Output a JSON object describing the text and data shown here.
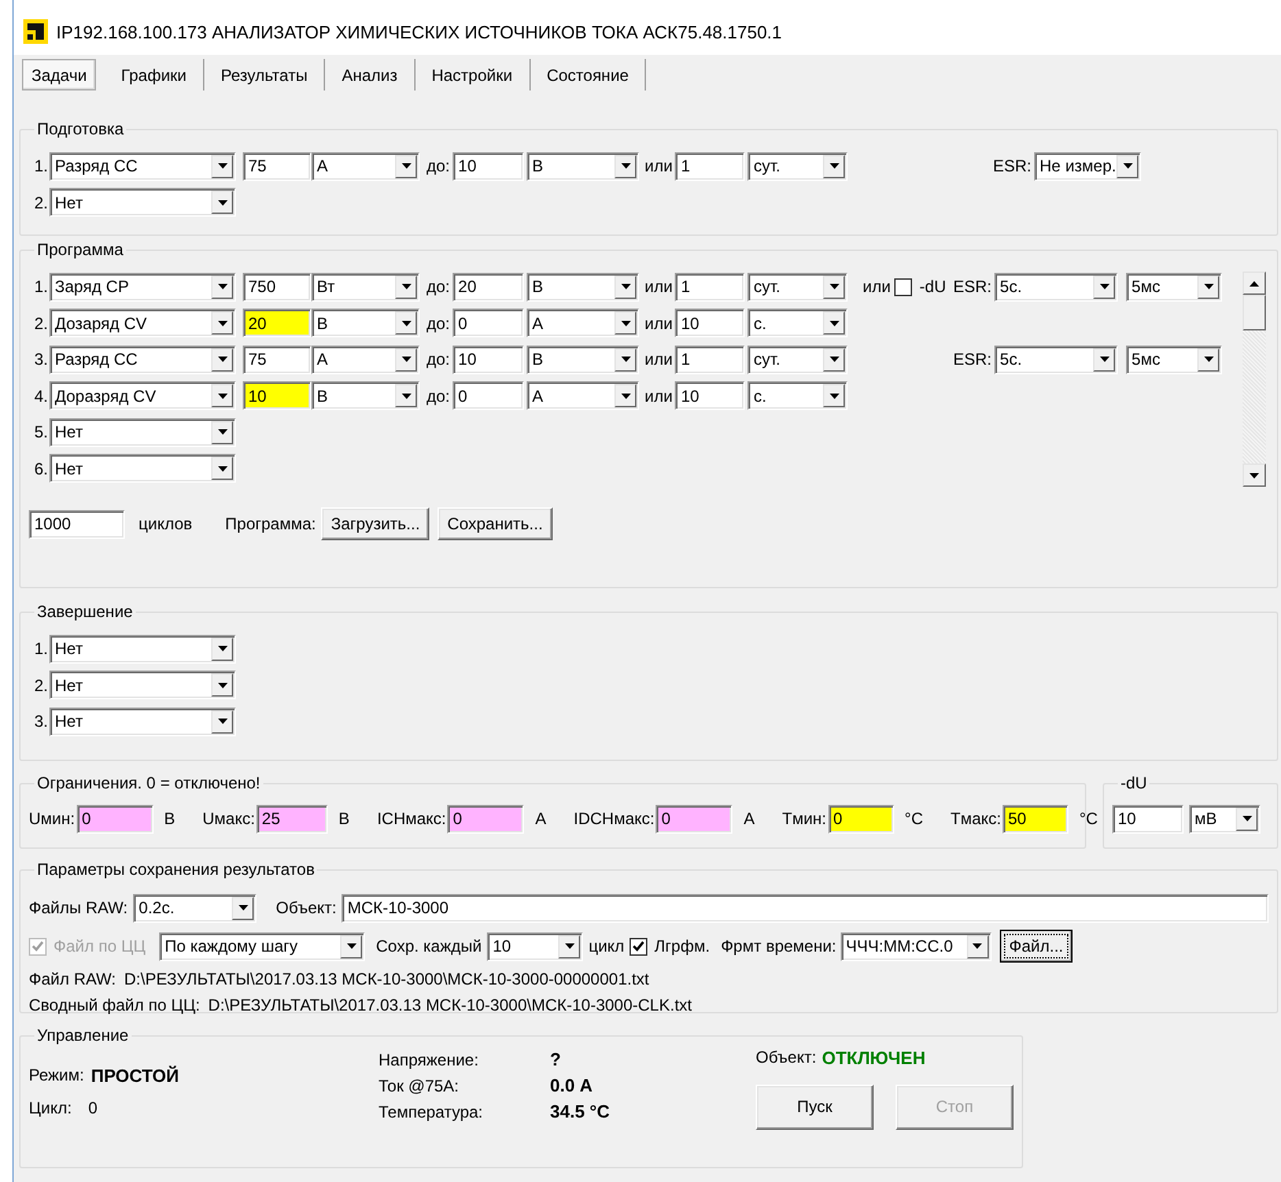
{
  "window": {
    "title": "IP192.168.100.173 АНАЛИЗАТОР ХИМИЧЕСКИХ ИСТОЧНИКОВ ТОКА АСК75.48.1750.1"
  },
  "tabs": [
    {
      "label": "Задачи",
      "selected": true
    },
    {
      "label": "Графики",
      "selected": false
    },
    {
      "label": "Результаты",
      "selected": false
    },
    {
      "label": "Анализ",
      "selected": false
    },
    {
      "label": "Настройки",
      "selected": false
    },
    {
      "label": "Состояние",
      "selected": false
    }
  ],
  "preparation": {
    "title": "Подготовка",
    "steps": [
      {
        "number": "1.",
        "mode": "Разряд СС",
        "value": "75",
        "highlighted": false,
        "value_unit": "А",
        "limit_label": "до:",
        "limit": "10",
        "limit_unit": "В",
        "time_label": "или",
        "time": "1",
        "time_unit": "сут.",
        "esr_label": "ESR:",
        "esr_period": "Не измер."
      },
      {
        "number": "2.",
        "mode": "Нет"
      }
    ]
  },
  "program": {
    "title": "Программа",
    "steps": [
      {
        "number": "1.",
        "mode": "Заряд CP",
        "value": "750",
        "highlighted": false,
        "value_unit": "Вт",
        "limit_label": "до:",
        "limit": "20",
        "limit_unit": "В",
        "time_label": "или",
        "time": "1",
        "time_unit": "сут.",
        "du": {
          "or_label": "или",
          "checked": false,
          "label": "-dU"
        },
        "esr_label": "ESR:",
        "esr_period": "5с.",
        "esr_pulse": "5мс"
      },
      {
        "number": "2.",
        "mode": "Дозаряд CV",
        "value": "20",
        "highlighted": true,
        "value_unit": "В",
        "limit_label": "до:",
        "limit": "0",
        "limit_unit": "А",
        "time_label": "или",
        "time": "10",
        "time_unit": "с."
      },
      {
        "number": "3.",
        "mode": "Разряд СС",
        "value": "75",
        "highlighted": false,
        "value_unit": "А",
        "limit_label": "до:",
        "limit": "10",
        "limit_unit": "В",
        "time_label": "или",
        "time": "1",
        "time_unit": "сут.",
        "esr_label": "ESR:",
        "esr_period": "5с.",
        "esr_pulse": "5мс"
      },
      {
        "number": "4.",
        "mode": "Доразряд CV",
        "value": "10",
        "highlighted": true,
        "value_unit": "В",
        "limit_label": "до:",
        "limit": "0",
        "limit_unit": "А",
        "time_label": "или",
        "time": "10",
        "time_unit": "с."
      },
      {
        "number": "5.",
        "mode": "Нет"
      },
      {
        "number": "6.",
        "mode": "Нет"
      }
    ],
    "cycles": "1000",
    "cycles_label": "циклов",
    "program_label": "Программа:",
    "buttons": [
      "Загрузить...",
      "Сохранить..."
    ]
  },
  "completion": {
    "title": "Завершение",
    "steps": [
      {
        "number": "1.",
        "mode": "Нет"
      },
      {
        "number": "2.",
        "mode": "Нет"
      },
      {
        "number": "3.",
        "mode": "Нет"
      }
    ]
  },
  "limits": {
    "title": "Ограничения. 0 = отключено!",
    "items": [
      {
        "label": "Uмин:",
        "value": "0",
        "unit": "В",
        "color": "#ffb3ff"
      },
      {
        "label": "Uмакс:",
        "value": "25",
        "unit": "В",
        "color": "#ffb3ff"
      },
      {
        "label": "ICHмакс:",
        "value": "0",
        "unit": "А",
        "color": "#ffb3ff"
      },
      {
        "label": "IDCHмакс:",
        "value": "0",
        "unit": "А",
        "color": "#ffb3ff"
      },
      {
        "label": "Tмин:",
        "value": "0",
        "unit": "°C",
        "color": "#ffff00"
      },
      {
        "label": "Tмакс:",
        "value": "50",
        "unit": "°C",
        "color": "#ffff00"
      }
    ]
  },
  "du": {
    "title": "-dU",
    "value": "10",
    "unit": "мВ"
  },
  "saving": {
    "title": "Параметры сохранения результатов",
    "raw_label": "Файлы RAW:",
    "raw_period": "0.2с.",
    "object_label": "Объект:",
    "object": "МСК-10-3000",
    "cycle_file": {
      "label": "Файл по ЦЦ",
      "checked": true,
      "disabled": true
    },
    "cycle_mode": "По каждому шагу",
    "save_every_label": "Сохр. каждый",
    "save_every": "10",
    "cycle_label": "цикл",
    "log": {
      "label": "Лгрфм.",
      "checked": true,
      "disabled": false
    },
    "time_format_label": "Фрмт времени:",
    "time_format": "ЧЧЧ:ММ:СС.0",
    "file_button": {
      "label": "Файл...",
      "focused": true
    },
    "paths": [
      {
        "label": "Файл RAW:",
        "path": "D:\\РЕЗУЛЬТАТЫ\\2017.03.13 МСК-10-3000\\МСК-10-3000-00000001.txt"
      },
      {
        "label": "Сводный файл по ЦЦ:",
        "path": "D:\\РЕЗУЛЬТАТЫ\\2017.03.13 МСК-10-3000\\МСК-10-3000-CLK.txt"
      }
    ]
  },
  "control": {
    "title": "Управление",
    "mode_label": "Режим:",
    "mode": "ПРОСТОЙ",
    "cycle_label": "Цикл:",
    "cycle": "0",
    "readings": [
      {
        "label": "Напряжение:",
        "value": "?"
      },
      {
        "label": "Ток @75А:",
        "value": "0.0 А"
      },
      {
        "label": "Температура:",
        "value": "34.5 °C"
      }
    ],
    "object_label": "Объект:",
    "object_status": "ОТКЛЮЧЕН",
    "color": "#008000",
    "buttons": [
      {
        "label": "Пуск",
        "disabled": false
      },
      {
        "label": "Стоп",
        "disabled": true
      }
    ]
  }
}
